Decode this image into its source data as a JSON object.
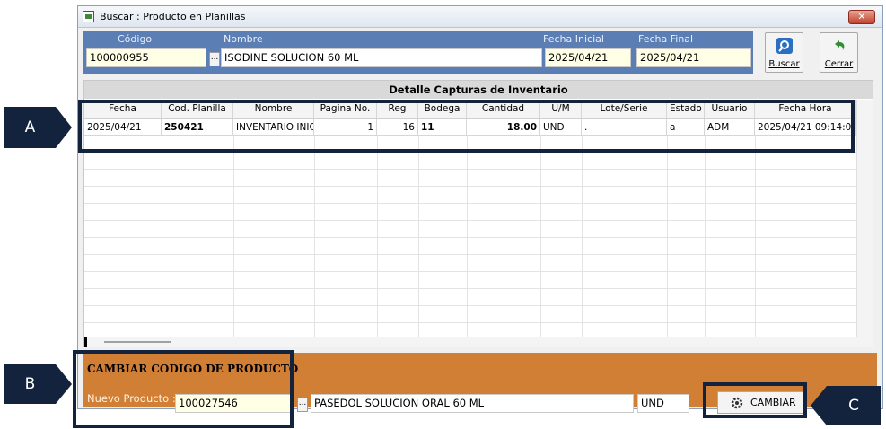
{
  "window": {
    "title": "Buscar : Producto en Planillas",
    "close_label": "✕"
  },
  "search": {
    "codigo_label": "Código",
    "codigo_value": "100000955",
    "nombre_label": "Nombre",
    "nombre_value": "ISODINE SOLUCION 60 ML",
    "fecha_inicial_label": "Fecha Inicial",
    "fecha_inicial_value": "2025/04/21",
    "fecha_final_label": "Fecha Final",
    "fecha_final_value": "2025/04/21",
    "ellipsis": "..."
  },
  "toolbar": {
    "buscar_label": "Buscar",
    "cerrar_label": "Cerrar"
  },
  "grid": {
    "title": "Detalle Capturas de Inventario",
    "columns": [
      "Fecha",
      "Cod. Planilla",
      "Nombre",
      "Pagina No.",
      "Reg",
      "Bodega",
      "Cantidad",
      "U/M",
      "Lote/Serie",
      "Estado",
      "Usuario",
      "Fecha Hora"
    ],
    "rows": [
      [
        "2025/04/21",
        "250421",
        "INVENTARIO INIC",
        "1",
        "16",
        "11",
        "18.00",
        "UND",
        ".",
        "a",
        "ADM",
        "2025/04/21 09:14:07"
      ]
    ]
  },
  "change_panel": {
    "title": "CAMBIAR  CODIGO DE PRODUCTO",
    "nuevo_label": "Nuevo Producto :",
    "nuevo_value": "100027546",
    "nuevo_nombre": "PASEDOL SOLUCION ORAL 60 ML",
    "unidad": "UND",
    "cambiar_label": "CAMBIAR"
  },
  "annotations": {
    "a": "A",
    "b": "B",
    "c": "C"
  },
  "colors": {
    "header_blue": "#5b7fb5",
    "orange": "#d27f36",
    "callout": "#14233d"
  }
}
